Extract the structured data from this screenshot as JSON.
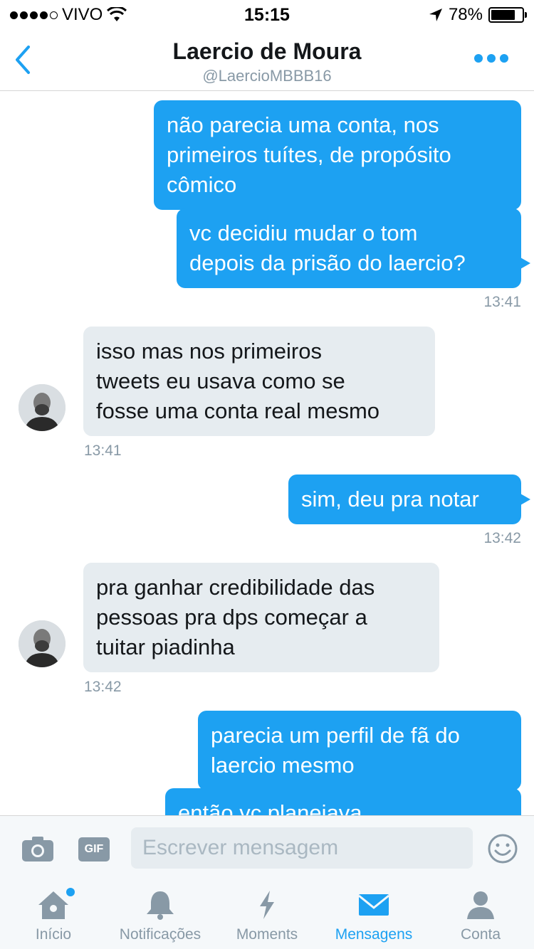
{
  "status_bar": {
    "carrier": "VIVO",
    "time": "15:15",
    "battery": "78%",
    "battery_level": 0.78,
    "icons": [
      "signal-dots-icon",
      "wifi-icon",
      "location-arrow-icon",
      "battery-icon"
    ]
  },
  "header": {
    "title": "Laercio de Moura",
    "handle": "@LaercioMBBB16",
    "icons": [
      "back-chevron-icon",
      "more-dots-icon"
    ]
  },
  "messages": [
    {
      "direction": "out",
      "lines": [
        "não parecia uma conta, nos",
        "primeiros tuítes, de propósito",
        "cômico"
      ]
    },
    {
      "direction": "out",
      "lines": [
        "vc decidiu mudar o tom",
        "depois da prisão do laercio?"
      ],
      "time": "13:41"
    },
    {
      "direction": "in",
      "lines": [
        "isso mas nos primeiros",
        "tweets eu usava como se",
        "fosse uma conta real mesmo"
      ],
      "time": "13:41"
    },
    {
      "direction": "out",
      "lines": [
        "sim, deu pra notar"
      ],
      "time": "13:42"
    },
    {
      "direction": "in",
      "lines": [
        "pra ganhar credibilidade das",
        "pessoas pra dps começar a",
        "tuitar piadinha"
      ],
      "time": "13:42"
    },
    {
      "direction": "out",
      "lines": [
        "parecia um perfil de fã do",
        "laercio mesmo"
      ]
    },
    {
      "direction": "out",
      "lines": [
        "então vc planejava"
      ]
    }
  ],
  "compose": {
    "placeholder": "Escrever mensagem",
    "gif_label": "GIF",
    "icons": [
      "camera-icon",
      "gif-icon",
      "emoji-icon"
    ]
  },
  "tabbar": {
    "tabs": [
      {
        "label": "Início",
        "icon": "home-icon",
        "active": false,
        "badge": true
      },
      {
        "label": "Notificações",
        "icon": "bell-icon",
        "active": false
      },
      {
        "label": "Moments",
        "icon": "lightning-icon",
        "active": false
      },
      {
        "label": "Mensagens",
        "icon": "envelope-icon",
        "active": true
      },
      {
        "label": "Conta",
        "icon": "person-icon",
        "active": false
      }
    ]
  },
  "colors": {
    "accent": "#1da1f2",
    "incoming_bubble": "#e6ecf0",
    "muted_text": "#8899a6"
  }
}
